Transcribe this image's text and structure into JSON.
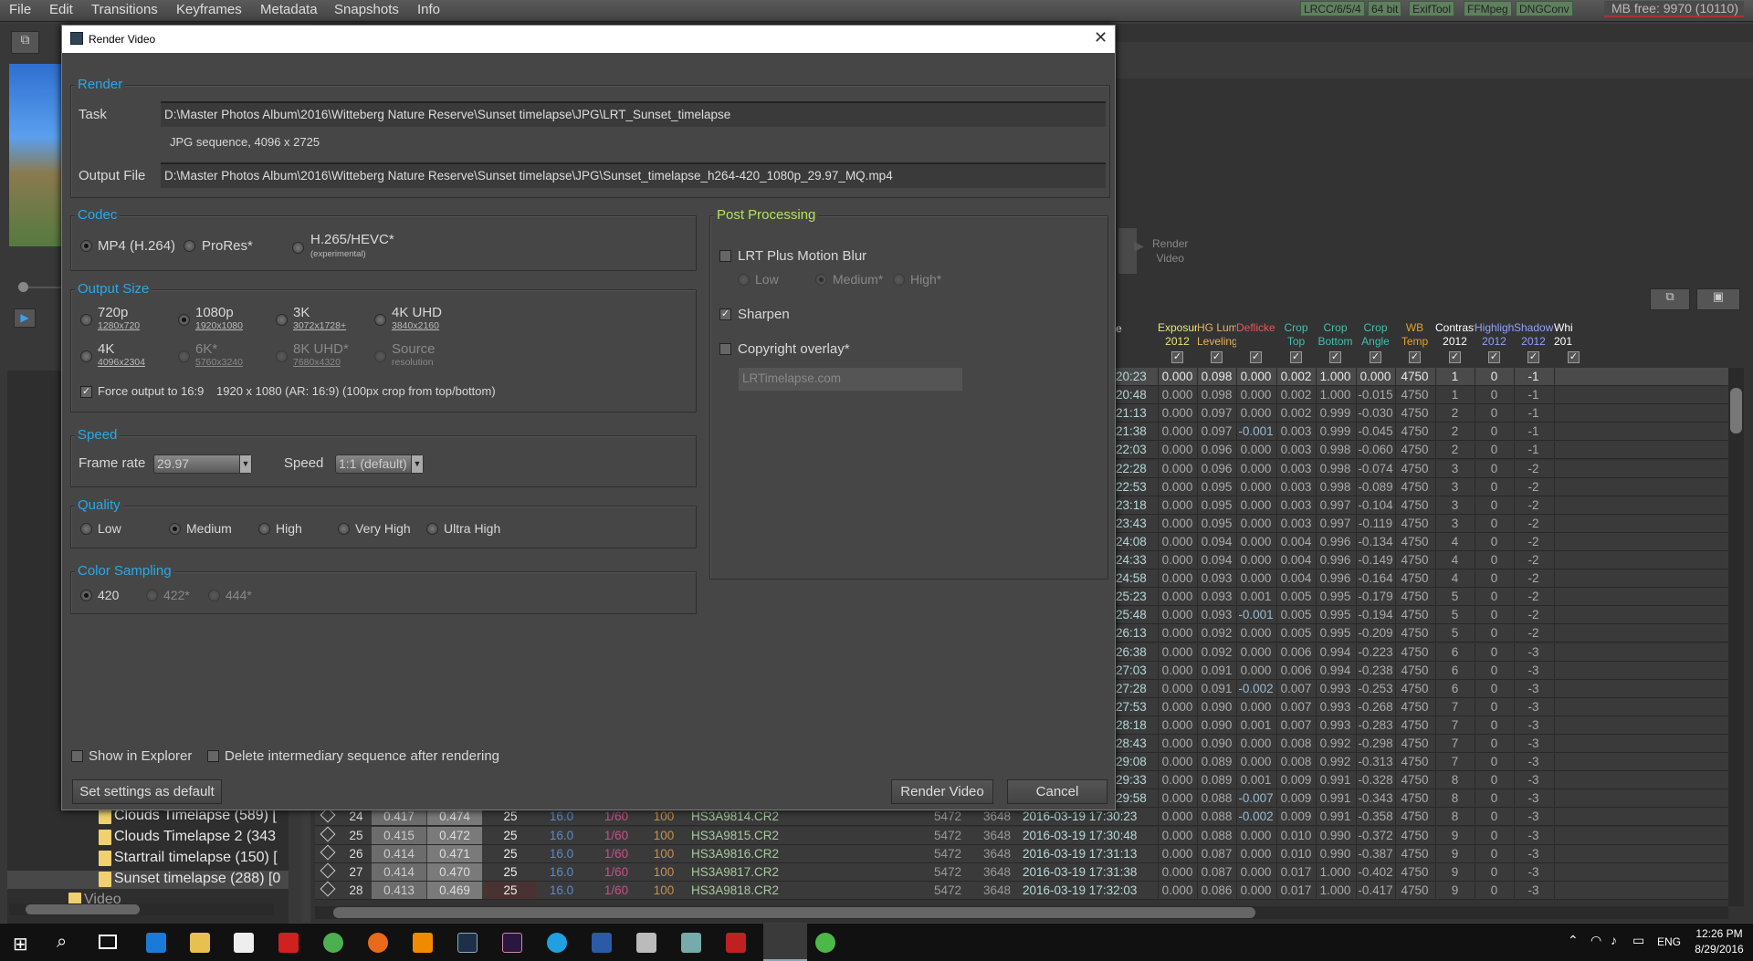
{
  "menubar": {
    "items": [
      "File",
      "Edit",
      "Transitions",
      "Keyframes",
      "Metadata",
      "Snapshots",
      "Info"
    ],
    "badges": [
      "LRCC/6/5/4",
      "64 bit",
      "ExifTool",
      "FFMpeg",
      "DNGConv"
    ],
    "mb_free": "MB free: 9970 (10110)"
  },
  "background": {
    "render_video_side_label": "Render\nVideo",
    "tree": [
      "Clouds Timelapse (589) [",
      "Clouds Timelapse 2 (343",
      "Startrail timelapse (150) [",
      "Sunset timelapse (288) [0",
      "Video"
    ],
    "grid_header_partial": "e",
    "columns": [
      {
        "label": "Exposure\n2012",
        "color": "#e6e67a"
      },
      {
        "label": "HG Lum\nLeveling",
        "color": "#e8b060"
      },
      {
        "label": "Deflicker",
        "color": "#e05a5a"
      },
      {
        "label": "Crop\nTop",
        "color": "#40c0b0"
      },
      {
        "label": "Crop\nBottom",
        "color": "#40c0b0"
      },
      {
        "label": "Crop\nAngle",
        "color": "#40c0b0"
      },
      {
        "label": "WB\nTemp",
        "color": "#e8a020"
      },
      {
        "label": "Contrast\n2012",
        "color": "#ffffff"
      },
      {
        "label": "Highlights\n2012",
        "color": "#8fa0ff"
      },
      {
        "label": "Shadows\n2012",
        "color": "#8fa0ff"
      },
      {
        "label": "Whi\n201",
        "color": "#ffffff"
      }
    ],
    "rows": [
      {
        "t": "20:23",
        "v": [
          "0.000",
          "0.098",
          "0.000",
          "0.002",
          "1.000",
          "0.000",
          "4750",
          "1",
          "0",
          "-1"
        ]
      },
      {
        "t": "20:48",
        "v": [
          "0.000",
          "0.098",
          "0.000",
          "0.002",
          "1.000",
          "-0.015",
          "4750",
          "1",
          "0",
          "-1"
        ]
      },
      {
        "t": "21:13",
        "v": [
          "0.000",
          "0.097",
          "0.000",
          "0.002",
          "0.999",
          "-0.030",
          "4750",
          "2",
          "0",
          "-1"
        ]
      },
      {
        "t": "21:38",
        "v": [
          "0.000",
          "0.097",
          "-0.001",
          "0.003",
          "0.999",
          "-0.045",
          "4750",
          "2",
          "0",
          "-1"
        ]
      },
      {
        "t": "22:03",
        "v": [
          "0.000",
          "0.096",
          "0.000",
          "0.003",
          "0.998",
          "-0.060",
          "4750",
          "2",
          "0",
          "-1"
        ]
      },
      {
        "t": "22:28",
        "v": [
          "0.000",
          "0.096",
          "0.000",
          "0.003",
          "0.998",
          "-0.074",
          "4750",
          "3",
          "0",
          "-2"
        ]
      },
      {
        "t": "22:53",
        "v": [
          "0.000",
          "0.095",
          "0.000",
          "0.003",
          "0.998",
          "-0.089",
          "4750",
          "3",
          "0",
          "-2"
        ]
      },
      {
        "t": "23:18",
        "v": [
          "0.000",
          "0.095",
          "0.000",
          "0.003",
          "0.997",
          "-0.104",
          "4750",
          "3",
          "0",
          "-2"
        ]
      },
      {
        "t": "23:43",
        "v": [
          "0.000",
          "0.095",
          "0.000",
          "0.003",
          "0.997",
          "-0.119",
          "4750",
          "3",
          "0",
          "-2"
        ]
      },
      {
        "t": "24:08",
        "v": [
          "0.000",
          "0.094",
          "0.000",
          "0.004",
          "0.996",
          "-0.134",
          "4750",
          "4",
          "0",
          "-2"
        ]
      },
      {
        "t": "24:33",
        "v": [
          "0.000",
          "0.094",
          "0.000",
          "0.004",
          "0.996",
          "-0.149",
          "4750",
          "4",
          "0",
          "-2"
        ]
      },
      {
        "t": "24:58",
        "v": [
          "0.000",
          "0.093",
          "0.000",
          "0.004",
          "0.996",
          "-0.164",
          "4750",
          "4",
          "0",
          "-2"
        ]
      },
      {
        "t": "25:23",
        "v": [
          "0.000",
          "0.093",
          "0.001",
          "0.005",
          "0.995",
          "-0.179",
          "4750",
          "5",
          "0",
          "-2"
        ]
      },
      {
        "t": "25:48",
        "v": [
          "0.000",
          "0.093",
          "-0.001",
          "0.005",
          "0.995",
          "-0.194",
          "4750",
          "5",
          "0",
          "-2"
        ]
      },
      {
        "t": "26:13",
        "v": [
          "0.000",
          "0.092",
          "0.000",
          "0.005",
          "0.995",
          "-0.209",
          "4750",
          "5",
          "0",
          "-2"
        ]
      },
      {
        "t": "26:38",
        "v": [
          "0.000",
          "0.092",
          "0.000",
          "0.006",
          "0.994",
          "-0.223",
          "4750",
          "6",
          "0",
          "-3"
        ]
      },
      {
        "t": "27:03",
        "v": [
          "0.000",
          "0.091",
          "0.000",
          "0.006",
          "0.994",
          "-0.238",
          "4750",
          "6",
          "0",
          "-3"
        ]
      },
      {
        "t": "27:28",
        "v": [
          "0.000",
          "0.091",
          "-0.002",
          "0.007",
          "0.993",
          "-0.253",
          "4750",
          "6",
          "0",
          "-3"
        ]
      },
      {
        "t": "27:53",
        "v": [
          "0.000",
          "0.090",
          "0.000",
          "0.007",
          "0.993",
          "-0.268",
          "4750",
          "7",
          "0",
          "-3"
        ]
      },
      {
        "t": "28:18",
        "v": [
          "0.000",
          "0.090",
          "0.001",
          "0.007",
          "0.993",
          "-0.283",
          "4750",
          "7",
          "0",
          "-3"
        ]
      },
      {
        "t": "28:43",
        "v": [
          "0.000",
          "0.090",
          "0.000",
          "0.008",
          "0.992",
          "-0.298",
          "4750",
          "7",
          "0",
          "-3"
        ]
      },
      {
        "t": "29:08",
        "v": [
          "0.000",
          "0.089",
          "0.000",
          "0.008",
          "0.992",
          "-0.313",
          "4750",
          "7",
          "0",
          "-3"
        ]
      },
      {
        "t": "29:33",
        "v": [
          "0.000",
          "0.089",
          "0.001",
          "0.009",
          "0.991",
          "-0.328",
          "4750",
          "8",
          "0",
          "-3"
        ]
      },
      {
        "t": "29:58",
        "v": [
          "0.000",
          "0.088",
          "-0.007",
          "0.009",
          "0.991",
          "-0.343",
          "4750",
          "8",
          "0",
          "-3"
        ]
      },
      {
        "n": "24",
        "a": "0.417",
        "b": "0.474",
        "c": "25",
        "f": "16.0",
        "s": "1/60",
        "iso": "100",
        "file": "HS3A9814.CR2",
        "w": "5472",
        "h": "3648",
        "t": "2016-03-19 17:30:23",
        "v": [
          "0.000",
          "0.088",
          "-0.002",
          "0.009",
          "0.991",
          "-0.358",
          "4750",
          "8",
          "0",
          "-3"
        ]
      },
      {
        "n": "25",
        "a": "0.415",
        "b": "0.472",
        "c": "25",
        "f": "16.0",
        "s": "1/60",
        "iso": "100",
        "file": "HS3A9815.CR2",
        "w": "5472",
        "h": "3648",
        "t": "2016-03-19 17:30:48",
        "v": [
          "0.000",
          "0.088",
          "0.000",
          "0.010",
          "0.990",
          "-0.372",
          "4750",
          "9",
          "0",
          "-3"
        ]
      },
      {
        "n": "26",
        "a": "0.414",
        "b": "0.471",
        "c": "25",
        "f": "16.0",
        "s": "1/60",
        "iso": "100",
        "file": "HS3A9816.CR2",
        "w": "5472",
        "h": "3648",
        "t": "2016-03-19 17:31:13",
        "v": [
          "0.000",
          "0.087",
          "0.000",
          "0.010",
          "0.990",
          "-0.387",
          "4750",
          "9",
          "0",
          "-3"
        ]
      },
      {
        "n": "27",
        "a": "0.414",
        "b": "0.470",
        "c": "25",
        "f": "16.0",
        "s": "1/60",
        "iso": "100",
        "file": "HS3A9817.CR2",
        "w": "5472",
        "h": "3648",
        "t": "2016-03-19 17:31:38",
        "v": [
          "0.000",
          "0.087",
          "0.000",
          "0.017",
          "1.000",
          "-0.402",
          "4750",
          "9",
          "0",
          "-3"
        ]
      },
      {
        "n": "28",
        "a": "0.413",
        "b": "0.469",
        "c": "25",
        "f": "16.0",
        "s": "1/60",
        "iso": "100",
        "file": "HS3A9818.CR2",
        "w": "5472",
        "h": "3648",
        "t": "2016-03-19 17:32:03",
        "v": [
          "0.000",
          "0.086",
          "0.000",
          "0.017",
          "1.000",
          "-0.417",
          "4750",
          "9",
          "0",
          "-3"
        ]
      }
    ]
  },
  "dialog": {
    "title": "Render Video",
    "render": {
      "legend": "Render",
      "task_label": "Task",
      "task_value": "D:\\Master Photos Album\\2016\\Witteberg Nature Reserve\\Sunset timelapse\\JPG\\LRT_Sunset_timelapse",
      "task_info": "JPG sequence, 4096 x 2725",
      "output_label": "Output File",
      "output_value": "D:\\Master Photos Album\\2016\\Witteberg Nature Reserve\\Sunset timelapse\\JPG\\Sunset_timelapse_h264-420_1080p_29.97_MQ.mp4"
    },
    "codec": {
      "legend": "Codec",
      "options": [
        "MP4 (H.264)",
        "ProRes*",
        "H.265/HEVC*"
      ],
      "h265_note": "(experimental)",
      "selected": "MP4 (H.264)"
    },
    "output_size": {
      "legend": "Output Size",
      "options": [
        {
          "label": "720p",
          "res": "1280x720",
          "enabled": true
        },
        {
          "label": "1080p",
          "res": "1920x1080",
          "enabled": true,
          "selected": true
        },
        {
          "label": "3K",
          "res": "3072x1728+",
          "enabled": true
        },
        {
          "label": "4K UHD",
          "res": "3840x2160",
          "enabled": true
        },
        {
          "label": "4K",
          "res": "4096x2304",
          "enabled": true
        },
        {
          "label": "6K*",
          "res": "5760x3240",
          "enabled": false
        },
        {
          "label": "8K UHD*",
          "res": "7680x4320",
          "enabled": false
        },
        {
          "label": "Source",
          "res": "resolution",
          "enabled": false
        }
      ],
      "force_label": "Force output to 16:9",
      "force_checked": true,
      "force_info": "1920 x 1080 (AR: 16:9) (100px crop from top/bottom)"
    },
    "speed": {
      "legend": "Speed",
      "frame_rate_label": "Frame rate",
      "frame_rate_value": "29.97",
      "speed_label": "Speed",
      "speed_value": "1:1 (default)"
    },
    "quality": {
      "legend": "Quality",
      "options": [
        "Low",
        "Medium",
        "High",
        "Very High",
        "Ultra High"
      ],
      "selected": "Medium"
    },
    "color_sampling": {
      "legend": "Color Sampling",
      "options": [
        "420",
        "422*",
        "444*"
      ],
      "selected": "420"
    },
    "post": {
      "legend": "Post Processing",
      "motion_blur_label": "LRT Plus Motion Blur",
      "motion_blur_checked": false,
      "motion_blur_options": [
        "Low",
        "Medium*",
        "High*"
      ],
      "motion_blur_selected": "Medium*",
      "sharpen_label": "Sharpen",
      "sharpen_checked": true,
      "copyright_label": "Copyright overlay*",
      "copyright_checked": false,
      "copyright_placeholder": "LRTimelapse.com"
    },
    "show_in_explorer": "Show in Explorer",
    "delete_intermediary": "Delete intermediary sequence after rendering",
    "set_default": "Set settings as default",
    "render_button": "Render Video",
    "cancel_button": "Cancel"
  },
  "taskbar": {
    "lang": "ENG",
    "time": "12:26 PM",
    "date": "8/29/2016"
  },
  "colors": {
    "accent": "#2aa8e8",
    "post_legend": "#b8e060"
  }
}
